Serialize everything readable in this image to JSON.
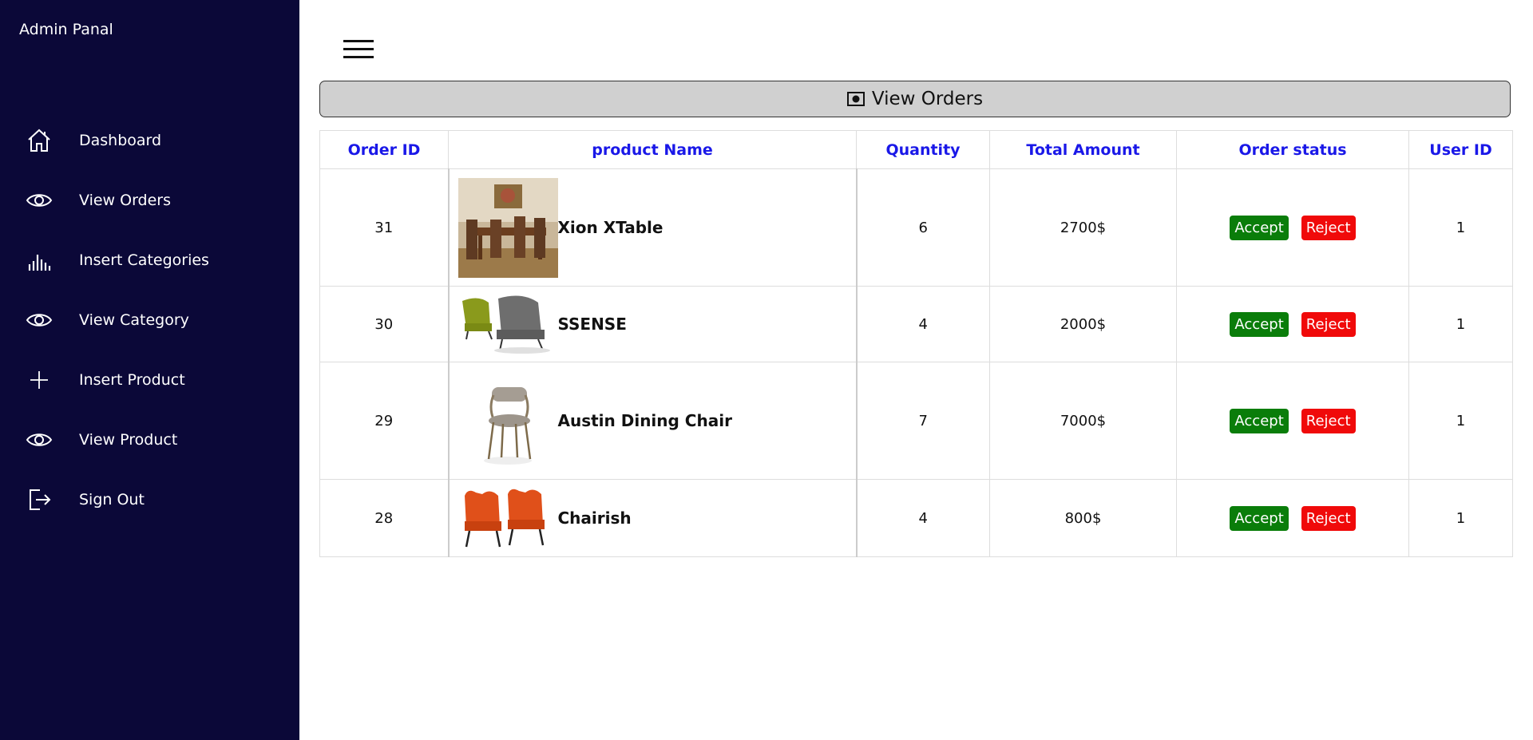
{
  "sidebar": {
    "brand": "Admin Panal",
    "items": [
      {
        "label": "Dashboard",
        "icon": "home-icon"
      },
      {
        "label": "View Orders",
        "icon": "eye-icon"
      },
      {
        "label": "Insert Categories",
        "icon": "bar-chart-icon"
      },
      {
        "label": "View Category",
        "icon": "eye-icon"
      },
      {
        "label": "Insert Product",
        "icon": "plus-icon"
      },
      {
        "label": "View Product",
        "icon": "eye-icon"
      },
      {
        "label": "Sign Out",
        "icon": "sign-out-icon"
      }
    ]
  },
  "banner": {
    "title": "View Orders",
    "icon": "money-icon"
  },
  "table": {
    "headers": [
      "Order ID",
      "product Name",
      "Quantity",
      "Total Amount",
      "Order status",
      "User ID"
    ],
    "rows": [
      {
        "order_id": "31",
        "product": "Xion XTable",
        "quantity": "6",
        "total": "2700$",
        "user_id": "1",
        "image": "dining-table-image"
      },
      {
        "order_id": "30",
        "product": "SSENSE",
        "quantity": "4",
        "total": "2000$",
        "user_id": "1",
        "image": "lounge-chairs-image"
      },
      {
        "order_id": "29",
        "product": "Austin Dining Chair",
        "quantity": "7",
        "total": "7000$",
        "user_id": "1",
        "image": "dining-chair-image"
      },
      {
        "order_id": "28",
        "product": "Chairish",
        "quantity": "4",
        "total": "800$",
        "user_id": "1",
        "image": "orange-chairs-image"
      }
    ],
    "accept_label": "Accept",
    "reject_label": "Reject"
  },
  "colors": {
    "sidebar_bg": "#0b0838",
    "header_text": "#1a18e8",
    "accept": "#0a7d0a",
    "reject": "#f00a0a"
  }
}
